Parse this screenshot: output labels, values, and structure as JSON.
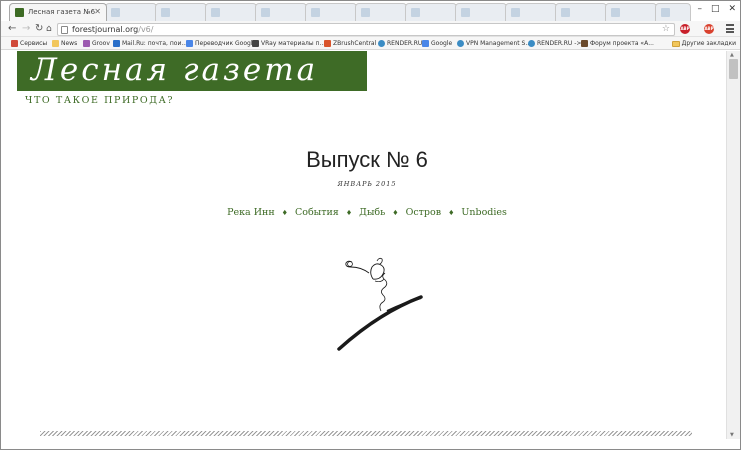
{
  "browser": {
    "tabs": [
      {
        "title": "Лесная газета №6",
        "active": true
      },
      {
        "title": "",
        "active": false
      },
      {
        "title": "",
        "active": false
      },
      {
        "title": "",
        "active": false
      },
      {
        "title": "",
        "active": false
      },
      {
        "title": "",
        "active": false
      },
      {
        "title": "",
        "active": false
      },
      {
        "title": "",
        "active": false
      },
      {
        "title": "",
        "active": false
      },
      {
        "title": "",
        "active": false
      },
      {
        "title": "",
        "active": false
      },
      {
        "title": "",
        "active": false
      }
    ],
    "url_host": "forestjournal.org",
    "url_path": "/v6/",
    "bookmarks": [
      {
        "label": "Сервисы",
        "icon": "apps-icon",
        "color": "#d04a3a"
      },
      {
        "label": "News",
        "icon": "folder-icon",
        "color": "#f2c75c"
      },
      {
        "label": "Groov",
        "icon": "groov-icon",
        "color": "#9c5bb0"
      },
      {
        "label": "Mail.Ru: почта, пои...",
        "icon": "mailru-icon",
        "color": "#2a6fc9"
      },
      {
        "label": "Переводчик Google",
        "icon": "translate-icon",
        "color": "#4a86e8"
      },
      {
        "label": "VRay материалы п...",
        "icon": "vray-icon",
        "color": "#444444"
      },
      {
        "label": "ZBrushCentral",
        "icon": "zbrush-icon",
        "color": "#d9542b"
      },
      {
        "label": "RENDER.RU",
        "icon": "render-icon",
        "color": "#3b8cc4"
      },
      {
        "label": "Google",
        "icon": "google-icon",
        "color": "#4a86e8"
      },
      {
        "label": "VPN Management S...",
        "icon": "vpn-icon",
        "color": "#3b8cc4"
      },
      {
        "label": "RENDER.RU ->",
        "icon": "render-icon",
        "color": "#3b8cc4"
      },
      {
        "label": "Форум проекта «А...",
        "icon": "forum-icon",
        "color": "#6b4a2b"
      }
    ],
    "other_bookmarks": "Другие закладки",
    "extensions": [
      {
        "label": "ABP",
        "icon": "abp-icon",
        "color": "#c8202a"
      },
      {
        "label": "ABP",
        "icon": "adblock-icon",
        "color": "#d9412e"
      }
    ]
  },
  "page": {
    "site_title": "Лесная газета",
    "tagline": "ЧТО ТАКОЕ ПРИРОДА?",
    "issue_title": "Выпуск № 6",
    "issue_date": "ЯНВАРЬ 2015",
    "nav": [
      "Река Инн",
      "События",
      "Дыбь",
      "Остров",
      "Unbodies"
    ],
    "nav_separator": "♦",
    "colors": {
      "brand_green": "#3e6b26",
      "text": "#222222"
    }
  }
}
